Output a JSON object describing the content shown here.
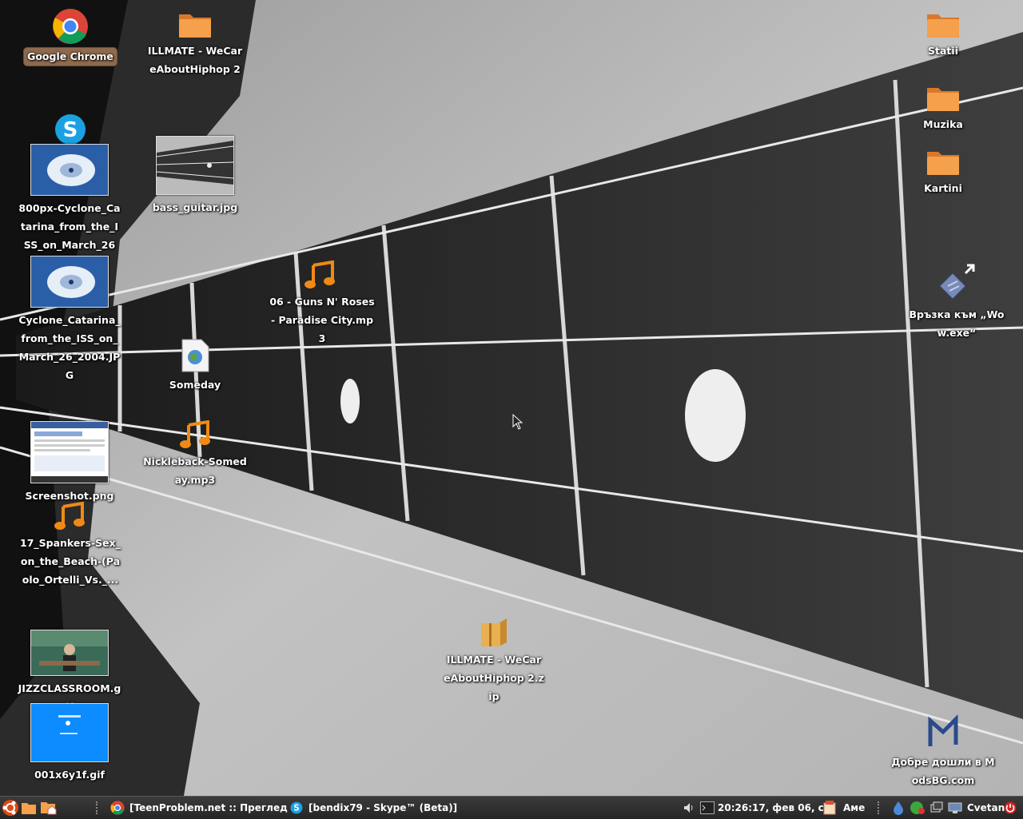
{
  "desktop": {
    "icons": {
      "chrome": "Google Chrome",
      "illmate_folder": "ILLMATE - WeCareAboutHiphop 2",
      "cyclone1": "800px-Cyclone_Catarina_from_the_ISS_on_March_26_...",
      "bass_guitar": "bass_guitar.jpg",
      "cyclone2": "Cyclone_Catarina_from_the_ISS_on_March_26_2004.JPG",
      "guns_roses": "06 - Guns N' Roses - Paradise City.mp3",
      "someday": "Someday",
      "nickleback": "Nickleback-Someday.mp3",
      "screenshot": "Screenshot.png",
      "spankers": "17_Spankers-Sex_on_the_Beach-(Paolo_Ortelli_Vs._...",
      "jizz": "JIZZCLASSROOM.gif",
      "gif001": "001x6y1f.gif",
      "illmate_zip": "ILLMATE - WeCareAboutHiphop 2.zip",
      "statii": "Statii",
      "muzika": "Muzika",
      "kartini": "Kartini",
      "wow": "Връзка към „Wow.exe“",
      "modsbg": "Добре дошли в ModsBG.com"
    }
  },
  "taskbar": {
    "tasks": [
      "[TeenProblem.net :: Преглед ...",
      "[bendix79 - Skype™ (Beta)]"
    ],
    "clock": "20:26:17, фев 06, сб",
    "keyboard": "Аме",
    "user": "Cvetan"
  },
  "colors": {
    "folder": "#f0973a",
    "note": "#f08a14",
    "taskbar": "#2f2f2f",
    "selection": "#8e6a4e"
  }
}
